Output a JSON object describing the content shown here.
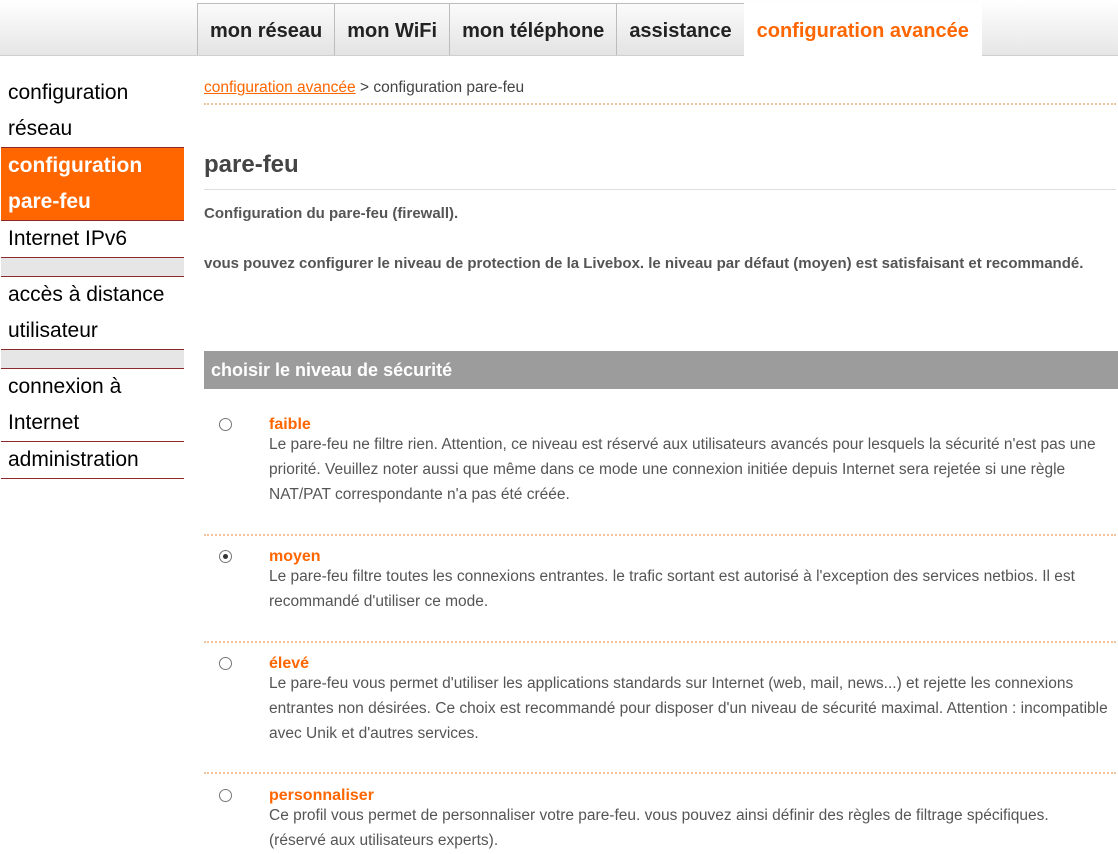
{
  "nav": {
    "tabs": [
      {
        "label": "mon réseau"
      },
      {
        "label": "mon WiFi"
      },
      {
        "label": "mon téléphone"
      },
      {
        "label": "assistance"
      },
      {
        "label": "configuration avancée"
      }
    ],
    "active_tab": "configuration avancée"
  },
  "sidebar": {
    "items": [
      {
        "label": "configuration réseau"
      },
      {
        "label": "configuration pare-feu"
      },
      {
        "label": "Internet IPv6"
      },
      {
        "label": "accès à distance utilisateur"
      },
      {
        "label": "connexion à Internet"
      },
      {
        "label": "administration"
      }
    ],
    "active_item": "configuration pare-feu"
  },
  "breadcrumb": {
    "parent": "configuration avancée",
    "separator": ">",
    "current": "configuration pare-feu"
  },
  "page": {
    "title": "pare-feu",
    "intro": "Configuration du pare-feu (firewall).",
    "description": "vous pouvez configurer le niveau de protection de la Livebox. le niveau par défaut (moyen) est satisfaisant et recommandé."
  },
  "security": {
    "header": "choisir le niveau de sécurité",
    "selected": "moyen",
    "options": [
      {
        "label": "faible",
        "text": "Le pare-feu ne filtre rien. Attention, ce niveau est réservé aux utilisateurs avancés pour lesquels la sécurité n'est pas une priorité. Veuillez noter aussi que même dans ce mode une connexion initiée depuis Internet sera rejetée si une règle NAT/PAT correspondante n'a pas été créée."
      },
      {
        "label": "moyen",
        "text": "Le pare-feu filtre toutes les connexions entrantes. le trafic sortant est autorisé à l'exception des services netbios. Il est recommandé d'utiliser ce mode."
      },
      {
        "label": "élevé",
        "text": "Le pare-feu vous permet d'utiliser les applications standards sur Internet (web, mail, news...) et rejette les connexions entrantes non désirées. Ce choix est recommandé pour disposer d'un niveau de sécurité maximal. Attention : incompatible avec Unik et d'autres services."
      },
      {
        "label": "personnaliser",
        "text": "Ce profil vous permet de personnaliser votre pare-feu. vous pouvez ainsi définir des règles de filtrage spécifiques. (réservé aux utilisateurs experts)."
      }
    ]
  },
  "colors": {
    "accent": "#ff6600",
    "section_header": "#9c9c9c",
    "sidebar_border": "#8a2a2a"
  }
}
